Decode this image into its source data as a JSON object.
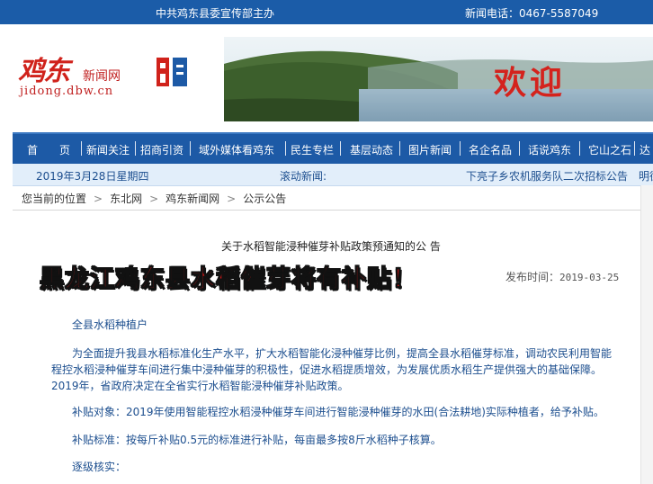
{
  "topbar": {
    "sponsor": "中共鸡东县委宣传部主办",
    "phone": "新闻电话：0467-5587049"
  },
  "logo": {
    "brand": "鸡东",
    "site": "新闻网",
    "domain": "jidong.dbw.cn"
  },
  "banner": {
    "welcome": "欢迎"
  },
  "nav": {
    "items": [
      "首　　页",
      "新闻关注",
      "招商引资",
      "域外媒体看鸡东",
      "民生专栏",
      "基层动态",
      "图片新闻",
      "名企名品",
      "话说鸡东",
      "它山之石",
      "达"
    ]
  },
  "infobar": {
    "date": "2019年3月28日星期四",
    "ticker_label": "滚动新闻:",
    "ticker_1": "下亮子乡农机服务队二次招标公告",
    "ticker_2": "明德"
  },
  "breadcrumb": {
    "prefix": "您当前的位置",
    "items": [
      "东北网",
      "鸡东新闻网",
      "公示公告"
    ]
  },
  "article": {
    "subhead": "关于水稻智能浸种催芽补贴政策预通知的公 告",
    "headline": "黑龙江鸡东县水稻催芽将有补贴！",
    "pubdate_label": "发布时间：",
    "pubdate": "2019-03-25",
    "salutation": "全县水稻种植户",
    "para1_line1": "为全面提升我县水稻标准化生产水平，扩大水稻智能化浸种催芽比例，提高全县水稻催芽标准，调动农民利用智能",
    "para1_line2": "程控水稻浸种催芽车间进行集中浸种催芽的积极性，促进水稻提质增效，为发展优质水稻生产提供强大的基础保障。",
    "para1_line3": "2019年，省政府决定在全省实行水稻智能浸种催芽补贴政策。",
    "para2": "补贴对象：2019年使用智能程控水稻浸种催芽车间进行智能浸种催芽的水田(合法耕地)实际种植者，给予补贴。",
    "para3": "补贴标准：按每斤补贴0.5元的标准进行补贴，每亩最多按8斤水稻种子核算。",
    "para4": "逐级核实："
  }
}
